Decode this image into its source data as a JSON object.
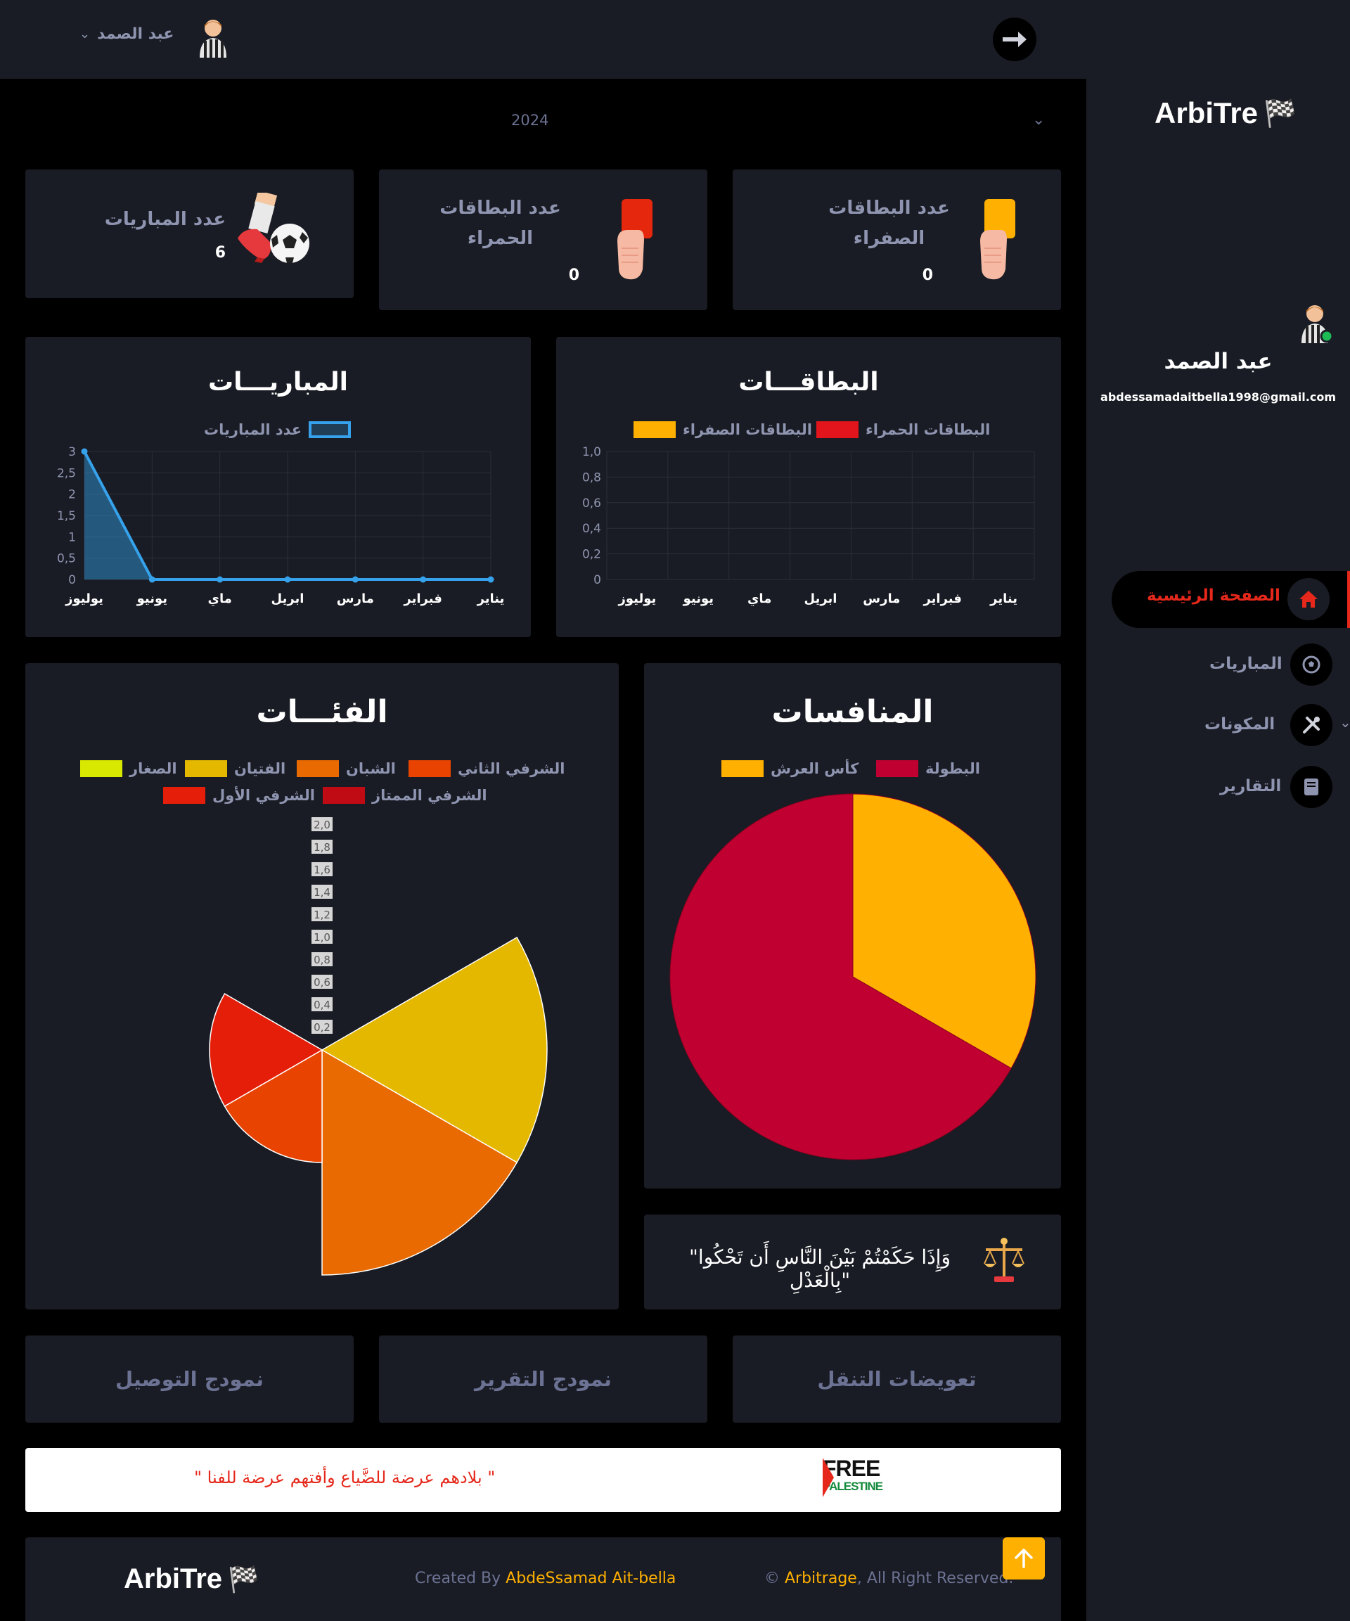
{
  "topbar": {
    "user_name": "عبد الصمد",
    "dropdown_icon": "chevron-down-icon",
    "arrow_icon": "arrow-right-icon"
  },
  "year_filter": {
    "value": "2024"
  },
  "stats": {
    "yellow_cards": {
      "label": "عدد البطاقات الصفراء",
      "value": "0"
    },
    "red_cards": {
      "label": "عدد البطاقات الحمراء",
      "value": "0"
    },
    "matches": {
      "label": "عدد المباريات",
      "value": "6"
    }
  },
  "sidebar": {
    "brand": "ArbiTre",
    "user_name": "عبد الصمد",
    "email": "abdessamadaitbella1998@gmail.com",
    "nav": [
      {
        "label": "الصفحة الرئيسية",
        "icon": "home-icon",
        "active": true
      },
      {
        "label": "المباريات",
        "icon": "soccer-ball-icon"
      },
      {
        "label": "المكونات",
        "icon": "tools-icon"
      },
      {
        "label": "التقارير",
        "icon": "book-icon"
      }
    ]
  },
  "colors": {
    "yellow": "#ffb000",
    "red": "#e1151b",
    "line_blue": "#36a2eb",
    "crimson": "#c00030"
  },
  "chart_data": [
    {
      "type": "line",
      "title": "المباريـــات",
      "categories": [
        "يناير",
        "فبراير",
        "مارس",
        "ابريل",
        "ماي",
        "يونيو",
        "يوليوز"
      ],
      "series": [
        {
          "name": "عدد المباريات",
          "values": [
            0,
            0,
            0,
            0,
            0,
            0,
            3
          ]
        }
      ],
      "y_ticks": [
        "0",
        "0,5",
        "1",
        "1,5",
        "2",
        "2,5",
        "3"
      ],
      "ylim": [
        0,
        3
      ],
      "x_order": "right-to-left",
      "grid": true
    },
    {
      "type": "bar",
      "title": "البطاقـــات",
      "categories": [
        "يناير",
        "فبراير",
        "مارس",
        "ابريل",
        "ماي",
        "يونيو",
        "يوليوز"
      ],
      "series": [
        {
          "name": "البطاقات الحمراء",
          "values": [
            0,
            0,
            0,
            0,
            0,
            0,
            0
          ]
        },
        {
          "name": "البطاقات الصفراء",
          "values": [
            0,
            0,
            0,
            0,
            0,
            0,
            0
          ]
        }
      ],
      "y_ticks": [
        "0",
        "0,2",
        "0,4",
        "0,6",
        "0,8",
        "1,0"
      ],
      "ylim": [
        0,
        1
      ],
      "x_order": "right-to-left",
      "grid": true
    },
    {
      "type": "polarArea",
      "title": "الفئـــات",
      "categories": [
        "الصغار",
        "الفتيان",
        "الشبان",
        "الشرفي الثاني",
        "الشرفي الأول",
        "الشرفي الممتاز"
      ],
      "values": [
        0,
        2,
        2,
        1,
        1,
        0
      ],
      "r_ticks": [
        "0,2",
        "0,4",
        "0,6",
        "0,8",
        "1,0",
        "1,2",
        "1,4",
        "1,6",
        "1,8",
        "2,0"
      ],
      "rlim": [
        0,
        2
      ],
      "legend_position": "top"
    },
    {
      "type": "pie",
      "title": "المنافسات",
      "categories": [
        "البطولة",
        "كأس العرش"
      ],
      "values": [
        4,
        2
      ],
      "legend_position": "top"
    }
  ],
  "quote": {
    "text": "\"وَإِذَا حَكَمْتُمْ بَيْنَ النَّاسِ أَن تَحْكُوا بِالْعَدْلِ\""
  },
  "doc_links": [
    {
      "label": "تعويضات التنقل"
    },
    {
      "label": "نمودج التقرير"
    },
    {
      "label": "نمودج التوصيل"
    }
  ],
  "banner": {
    "text": "\" بلادهم عرضة للضَّياع وأفتهم عرضة للفنا \"",
    "logo_text_1": "FREE",
    "logo_text_2": "PALESTINE"
  },
  "footer": {
    "brand": "ArbiTre",
    "created_prefix": "Created By ",
    "author": "AbdeSsamad Ait-bella",
    "copyright_prefix": "© ",
    "site": "Arbitrage",
    "rights": ", All Right Reserved."
  }
}
